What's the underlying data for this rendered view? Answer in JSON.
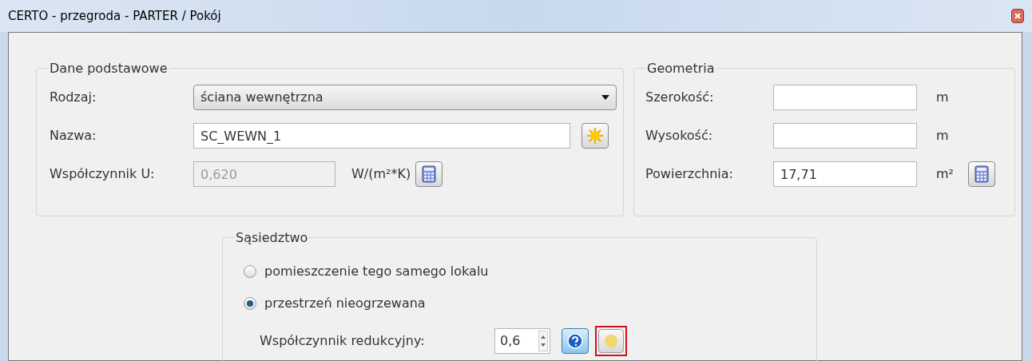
{
  "window": {
    "title": "CERTO - przegroda - PARTER / Pokój"
  },
  "basic": {
    "title": "Dane podstawowe",
    "type": {
      "label": "Rodzaj:",
      "value": "ściana wewnętrzna"
    },
    "name": {
      "label": "Nazwa:",
      "value": "SC_WEWN_1"
    },
    "u": {
      "label": "Współczynnik U:",
      "value": "0,620",
      "unit": "W/(m²*K)",
      "disabled": true
    }
  },
  "geometry": {
    "title": "Geometria",
    "fields": [
      {
        "label": "Szerokość:",
        "unit": "m",
        "calculator": false
      },
      {
        "label": "Wysokość:",
        "unit": "m",
        "calculator": false
      },
      {
        "label": "Powierzchnia:",
        "value": "17,71",
        "unit": "m²",
        "calculator": true
      }
    ]
  },
  "neighbourhood": {
    "title": "Sąsiedztwo",
    "options": [
      {
        "label": "pomieszczenie tego samego lokalu",
        "selected": false
      },
      {
        "label": "przestrzeń nieogrzewana",
        "selected": true
      }
    ],
    "reduction": {
      "label": "Współczynnik redukcyjny:",
      "value": "0,6",
      "highlighted": true
    }
  }
}
